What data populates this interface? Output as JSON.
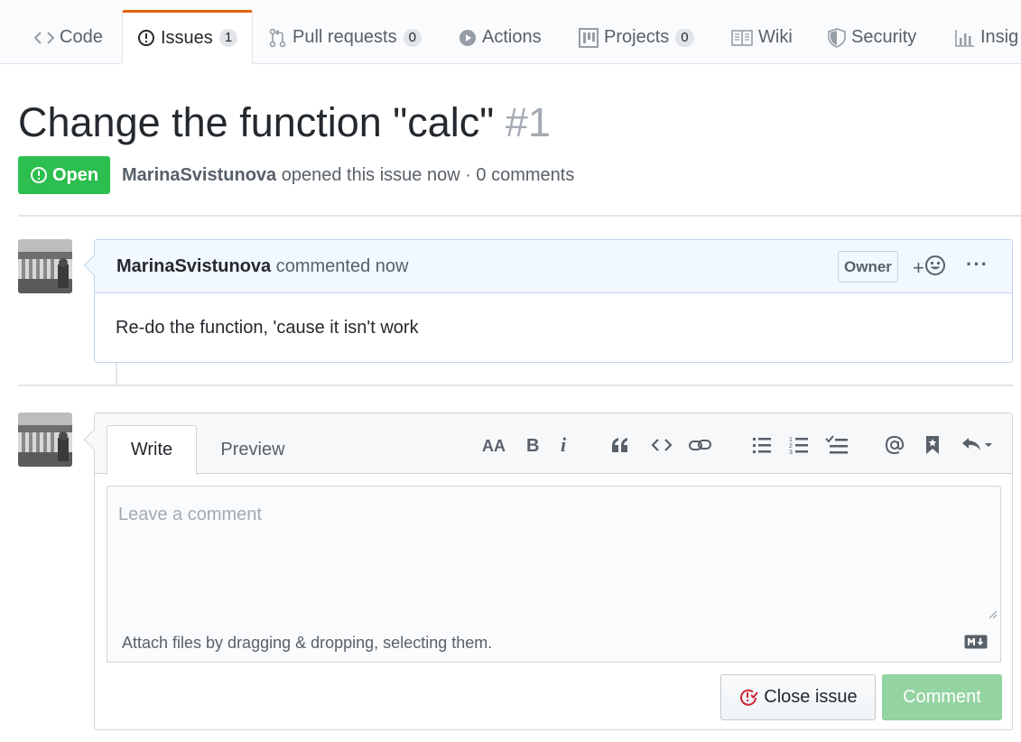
{
  "tabs": {
    "code": {
      "label": "Code",
      "icon": "code-icon"
    },
    "issues": {
      "label": "Issues",
      "count": "1",
      "icon": "issue-opened-icon"
    },
    "pulls": {
      "label": "Pull requests",
      "count": "0",
      "icon": "git-pull-request-icon"
    },
    "actions": {
      "label": "Actions",
      "icon": "play-icon"
    },
    "projects": {
      "label": "Projects",
      "count": "0",
      "icon": "project-icon"
    },
    "wiki": {
      "label": "Wiki",
      "icon": "book-icon"
    },
    "security": {
      "label": "Security",
      "icon": "shield-icon"
    },
    "insights": {
      "label": "Insig",
      "icon": "graph-icon"
    }
  },
  "issue": {
    "title": "Change the function \"calc\"",
    "number": "#1",
    "state": "Open",
    "author": "MarinaSvistunova",
    "meta_suffix": "opened this issue now · 0 comments"
  },
  "comment": {
    "author": "MarinaSvistunova",
    "action": "commented now",
    "role": "Owner",
    "reaction_plus": "+",
    "more": "···",
    "body": "Re-do the function, 'cause it isn't work"
  },
  "reply": {
    "write_tab": "Write",
    "preview_tab": "Preview",
    "placeholder": "Leave a comment",
    "attach_hint": "Attach files by dragging & dropping, selecting them.",
    "close_label": "Close issue",
    "comment_label": "Comment",
    "toolbar": [
      "text-size-icon",
      "bold-icon",
      "italic-icon",
      "quote-icon",
      "code-icon",
      "link-icon",
      "bulleted-list-icon",
      "numbered-list-icon",
      "task-list-icon",
      "mention-icon",
      "saved-reply-icon",
      "reply-icon"
    ]
  },
  "colors": {
    "open_green": "#2cbe4e",
    "tab_accent": "#e36209",
    "comment_header": "#f1f8ff",
    "comment_button_disabled": "#94d3a2",
    "close_issue_icon": "#cb2431"
  }
}
